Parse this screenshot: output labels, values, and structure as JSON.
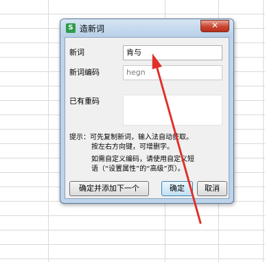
{
  "dialog": {
    "title": "造新词",
    "app_icon_letter": "S",
    "close_glyph": "✕"
  },
  "fields": {
    "new_word_label": "新词",
    "new_word_value": "肯与",
    "code_label": "新词编码",
    "code_value": "hegn",
    "dup_code_label": "已有重码"
  },
  "hints": {
    "line1": "提示：可先复制新词，输入法自动获取。",
    "line2": "按左右方向键，可增删字。",
    "line3": "如需自定义编码，请使用自定义短",
    "line4": "语（“设置属性”的“高级”页）。"
  },
  "buttons": {
    "confirm_add_next": "确定并添加下一个",
    "ok": "确定",
    "cancel": "取消"
  },
  "annotation": {
    "arrow_color": "#e0302a"
  }
}
